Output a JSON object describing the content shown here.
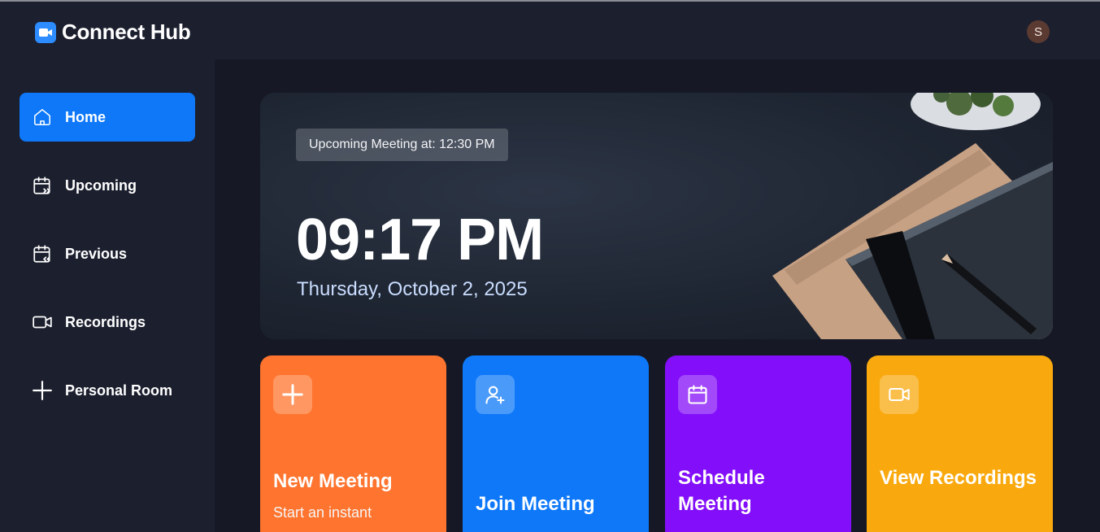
{
  "app": {
    "title": "Connect Hub",
    "user_initial": "S"
  },
  "sidebar": {
    "items": [
      {
        "label": "Home",
        "icon": "home-icon",
        "active": true
      },
      {
        "label": "Upcoming",
        "icon": "calendar-forward-icon",
        "active": false
      },
      {
        "label": "Previous",
        "icon": "calendar-back-icon",
        "active": false
      },
      {
        "label": "Recordings",
        "icon": "video-icon",
        "active": false
      },
      {
        "label": "Personal Room",
        "icon": "plus-icon",
        "active": false
      }
    ]
  },
  "hero": {
    "badge": "Upcoming Meeting at: 12:30 PM",
    "time": "09:17 PM",
    "date": "Thursday, October 2, 2025"
  },
  "cards": [
    {
      "title": "New Meeting",
      "subtitle": "Start an instant",
      "icon": "plus-icon",
      "color": "#ff742e"
    },
    {
      "title": "Join Meeting",
      "subtitle": "",
      "icon": "user-add-icon",
      "color": "#0e78f9"
    },
    {
      "title": "Schedule Meeting",
      "subtitle": "",
      "icon": "calendar-icon",
      "color": "#830ef9"
    },
    {
      "title": "View Recordings",
      "subtitle": "",
      "icon": "video-icon",
      "color": "#f9a90e"
    }
  ],
  "colors": {
    "background": "#161925",
    "sidebar": "#1c1f2e",
    "accent": "#0e78f9"
  }
}
